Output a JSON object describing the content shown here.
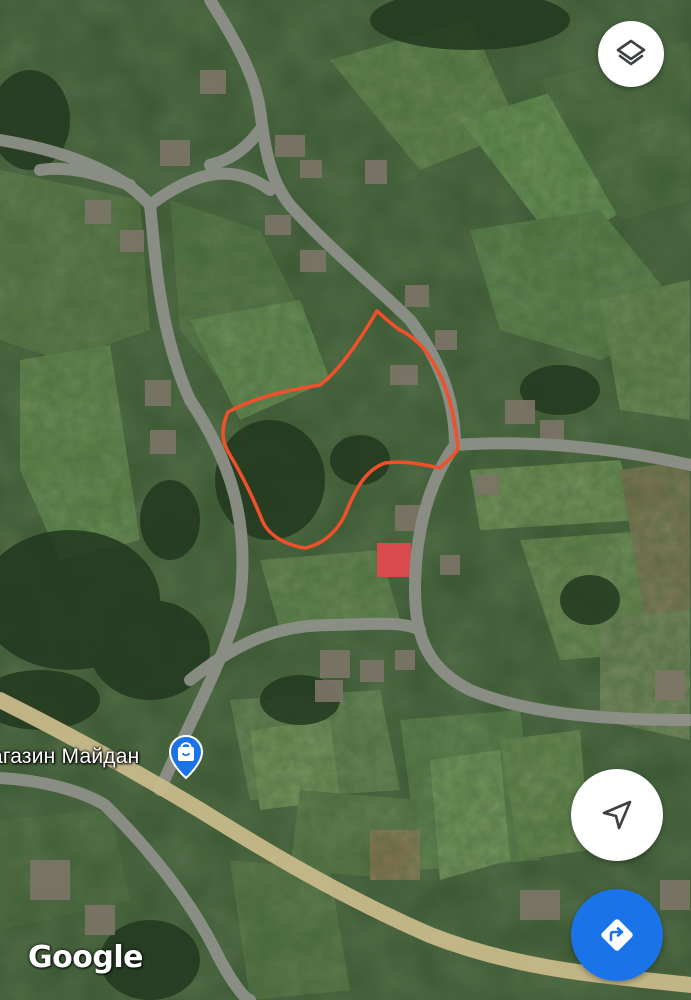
{
  "map": {
    "type": "satellite",
    "boundary_color": "#f0502a",
    "road_color": "#8d9088",
    "highway_color": "#c8b98a"
  },
  "poi": {
    "label": "агазин Майдан",
    "icon": "shopping-bag-icon",
    "marker_color": "#1a73e8"
  },
  "controls": {
    "layers_icon": "layers-icon",
    "my_location_icon": "navigation-arrow-icon",
    "directions_icon": "directions-icon",
    "directions_color": "#1a73e8"
  },
  "attribution": {
    "logo_text": "Google"
  }
}
